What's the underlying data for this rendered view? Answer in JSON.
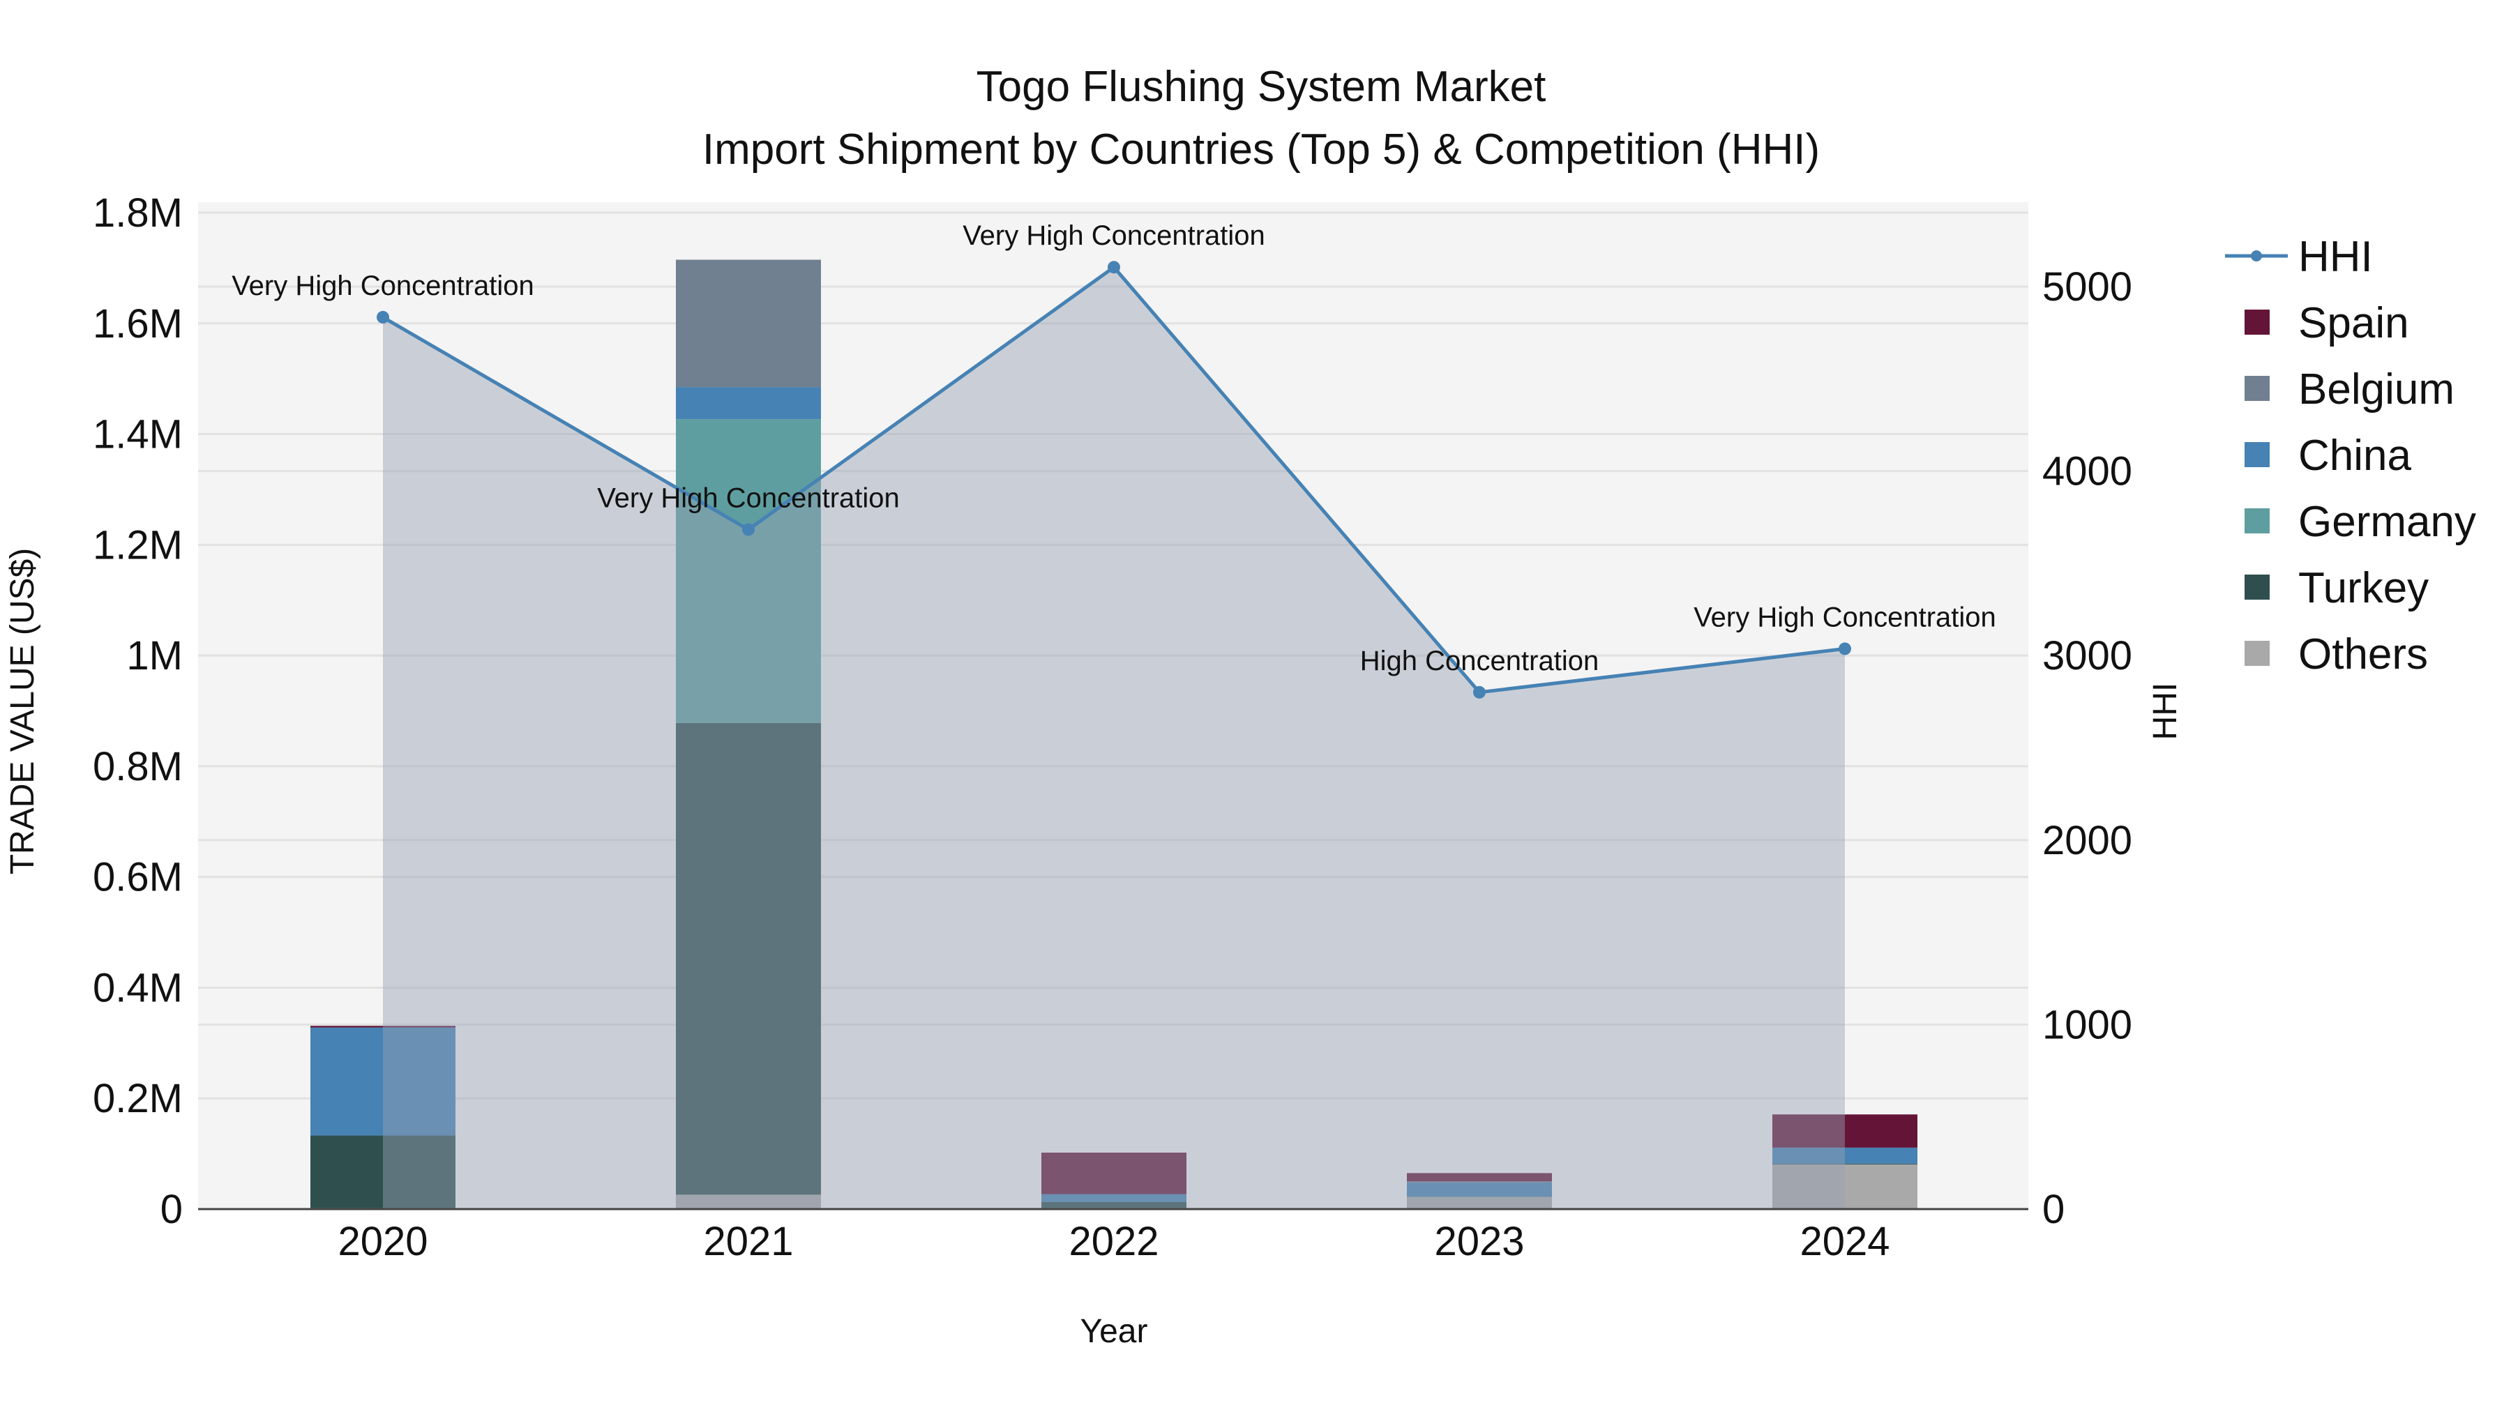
{
  "chart_data": {
    "type": "bar",
    "title": "Togo Flushing System Market",
    "subtitle": "Import Shipment by Countries (Top 5) & Competition (HHI)",
    "xlabel": "Year",
    "ylabel": "TRADE VALUE (US$)",
    "y2label": "HHI",
    "categories": [
      "2020",
      "2021",
      "2022",
      "2023",
      "2024"
    ],
    "ylim": [
      0,
      1800000
    ],
    "y2lim": [
      0,
      5400
    ],
    "yticks": [
      {
        "v": 0,
        "label": "0"
      },
      {
        "v": 200000,
        "label": "0.2M"
      },
      {
        "v": 400000,
        "label": "0.4M"
      },
      {
        "v": 600000,
        "label": "0.6M"
      },
      {
        "v": 800000,
        "label": "0.8M"
      },
      {
        "v": 1000000,
        "label": "1M"
      },
      {
        "v": 1200000,
        "label": "1.2M"
      },
      {
        "v": 1400000,
        "label": "1.4M"
      },
      {
        "v": 1600000,
        "label": "1.6M"
      },
      {
        "v": 1800000,
        "label": "1.8M"
      }
    ],
    "y2ticks": [
      {
        "v": 0,
        "label": "0"
      },
      {
        "v": 1000,
        "label": "1000"
      },
      {
        "v": 2000,
        "label": "2000"
      },
      {
        "v": 3000,
        "label": "3000"
      },
      {
        "v": 4000,
        "label": "4000"
      },
      {
        "v": 5000,
        "label": "5000"
      }
    ],
    "grid": true,
    "legend_placement": "right",
    "series": [
      {
        "name": "Others",
        "color": "#a9a9a9",
        "values": [
          2000,
          26000,
          2000,
          22000,
          81000
        ]
      },
      {
        "name": "Turkey",
        "color": "#2f4f4f",
        "values": [
          131000,
          852000,
          11000,
          0,
          1000
        ]
      },
      {
        "name": "Germany",
        "color": "#5f9ea0",
        "values": [
          0,
          549000,
          0,
          0,
          0
        ]
      },
      {
        "name": "China",
        "color": "#4682b4",
        "values": [
          195000,
          58000,
          14000,
          26000,
          29000
        ]
      },
      {
        "name": "Belgium",
        "color": "#708090",
        "values": [
          0,
          230000,
          0,
          2000,
          0
        ]
      },
      {
        "name": "Spain",
        "color": "#641537",
        "values": [
          3000,
          0,
          75000,
          15000,
          60000
        ]
      }
    ],
    "hhi": {
      "name": "HHI",
      "color": "#4682b4",
      "values": [
        4834,
        3683,
        5105,
        2801,
        3037
      ],
      "annotations": [
        "Very High Concentration",
        "Very High Concentration",
        "Very High Concentration",
        "High Concentration",
        "Very High Concentration"
      ]
    },
    "legend_order": [
      "HHI",
      "Spain",
      "Belgium",
      "China",
      "Germany",
      "Turkey",
      "Others"
    ]
  }
}
